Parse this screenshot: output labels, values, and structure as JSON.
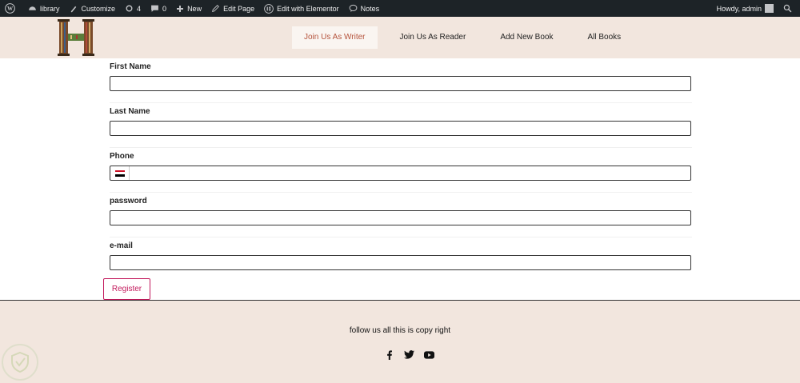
{
  "adminbar": {
    "site_name": "library",
    "customize": "Customize",
    "updates_count": "4",
    "comments_count": "0",
    "new_label": "New",
    "edit_page": "Edit Page",
    "elementor": "Edit with Elementor",
    "notes": "Notes",
    "howdy": "Howdy, admin"
  },
  "nav": {
    "items": [
      "Join Us As Writer",
      "Join Us As Reader",
      "Add New Book",
      "All Books"
    ]
  },
  "form": {
    "first_name_label": "First Name",
    "last_name_label": "Last Name",
    "phone_label": "Phone",
    "password_label": "password",
    "email_label": "e-mail",
    "first_name_value": "",
    "last_name_value": "",
    "phone_value": "",
    "password_value": "",
    "email_value": "",
    "register_label": "Register"
  },
  "footer": {
    "text": "follow us all this is copy right",
    "social_icons": [
      "facebook-icon",
      "twitter-icon",
      "youtube-icon"
    ]
  },
  "colors": {
    "header_bg": "#f2e6de",
    "adminbar_bg": "#1d2327",
    "accent": "#c2185b",
    "active_nav": "#b5533c"
  }
}
